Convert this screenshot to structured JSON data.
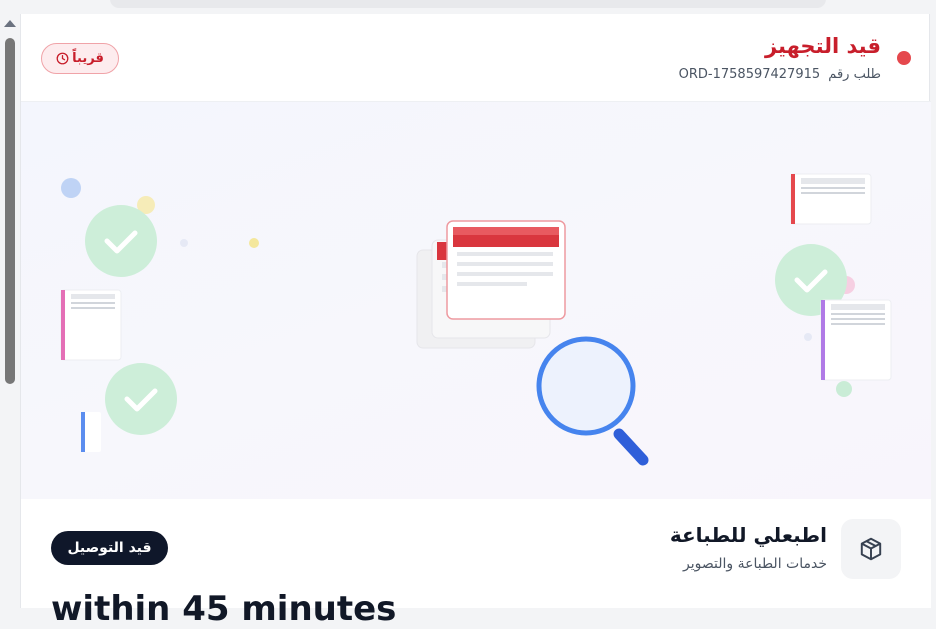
{
  "order": {
    "status_title": "قيد التجهيز",
    "order_label": "طلب رقم",
    "order_number": "ORD-1758597427915",
    "soon_badge": "قريباً",
    "status_color": "#e5484d"
  },
  "store": {
    "name": "اطبعلي للطباعة",
    "subtitle": "خدمات الطباعة والتصوير",
    "delivery_status": "قيد التوصيل"
  },
  "eta": {
    "text": "within 45 minutes"
  },
  "icons": {
    "clock": "clock-icon",
    "package": "package-icon",
    "search": "magnifier-icon",
    "check": "check-icon"
  }
}
